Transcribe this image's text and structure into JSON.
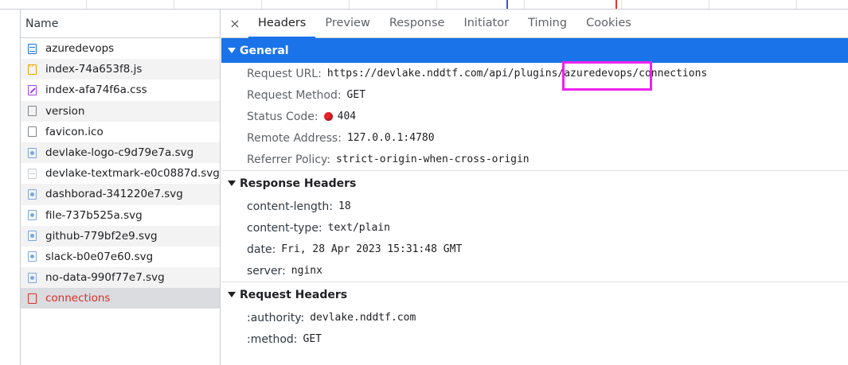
{
  "list": {
    "header": "Name",
    "rows": [
      {
        "name": "azuredevops",
        "icon": "document-icon"
      },
      {
        "name": "index-74a653f8.js",
        "icon": "script-icon"
      },
      {
        "name": "index-afa74f6a.css",
        "icon": "stylesheet-icon"
      },
      {
        "name": "version",
        "icon": "blank-file-icon"
      },
      {
        "name": "favicon.ico",
        "icon": "blank-file-icon"
      },
      {
        "name": "devlake-logo-c9d79e7a.svg",
        "icon": "image-icon"
      },
      {
        "name": "devlake-textmark-e0c0887d.svg",
        "icon": "image-icon"
      },
      {
        "name": "dashborad-341220e7.svg",
        "icon": "image-icon"
      },
      {
        "name": "file-737b525a.svg",
        "icon": "image-icon"
      },
      {
        "name": "github-779bf2e9.svg",
        "icon": "image-icon"
      },
      {
        "name": "slack-b0e07e60.svg",
        "icon": "image-icon"
      },
      {
        "name": "no-data-990f77e7.svg",
        "icon": "image-icon"
      },
      {
        "name": "connections",
        "icon": "error-file-icon"
      }
    ]
  },
  "tabs": {
    "close": "×",
    "items": [
      "Headers",
      "Preview",
      "Response",
      "Initiator",
      "Timing",
      "Cookies"
    ],
    "active": "Headers"
  },
  "general": {
    "title": "General",
    "request_url_label": "Request URL:",
    "request_url": "https://devlake.nddtf.com/api/plugins/azuredevops/connections",
    "request_method_label": "Request Method:",
    "request_method": "GET",
    "status_code_label": "Status Code:",
    "status_code": "404",
    "remote_address_label": "Remote Address:",
    "remote_address": "127.0.0.1:4780",
    "referrer_policy_label": "Referrer Policy:",
    "referrer_policy": "strict-origin-when-cross-origin"
  },
  "response_headers": {
    "title": "Response Headers",
    "items": [
      {
        "k": "content-length:",
        "v": "18"
      },
      {
        "k": "content-type:",
        "v": "text/plain"
      },
      {
        "k": "date:",
        "v": "Fri, 28 Apr 2023 15:31:48 GMT"
      },
      {
        "k": "server:",
        "v": "nginx"
      }
    ]
  },
  "request_headers": {
    "title": "Request Headers",
    "items": [
      {
        "k": ":authority:",
        "v": "devlake.nddtf.com"
      },
      {
        "k": ":method:",
        "v": "GET"
      }
    ]
  },
  "colors": {
    "accent": "#1a73e8",
    "error": "#d93025",
    "highlight": "#ee22ee"
  }
}
